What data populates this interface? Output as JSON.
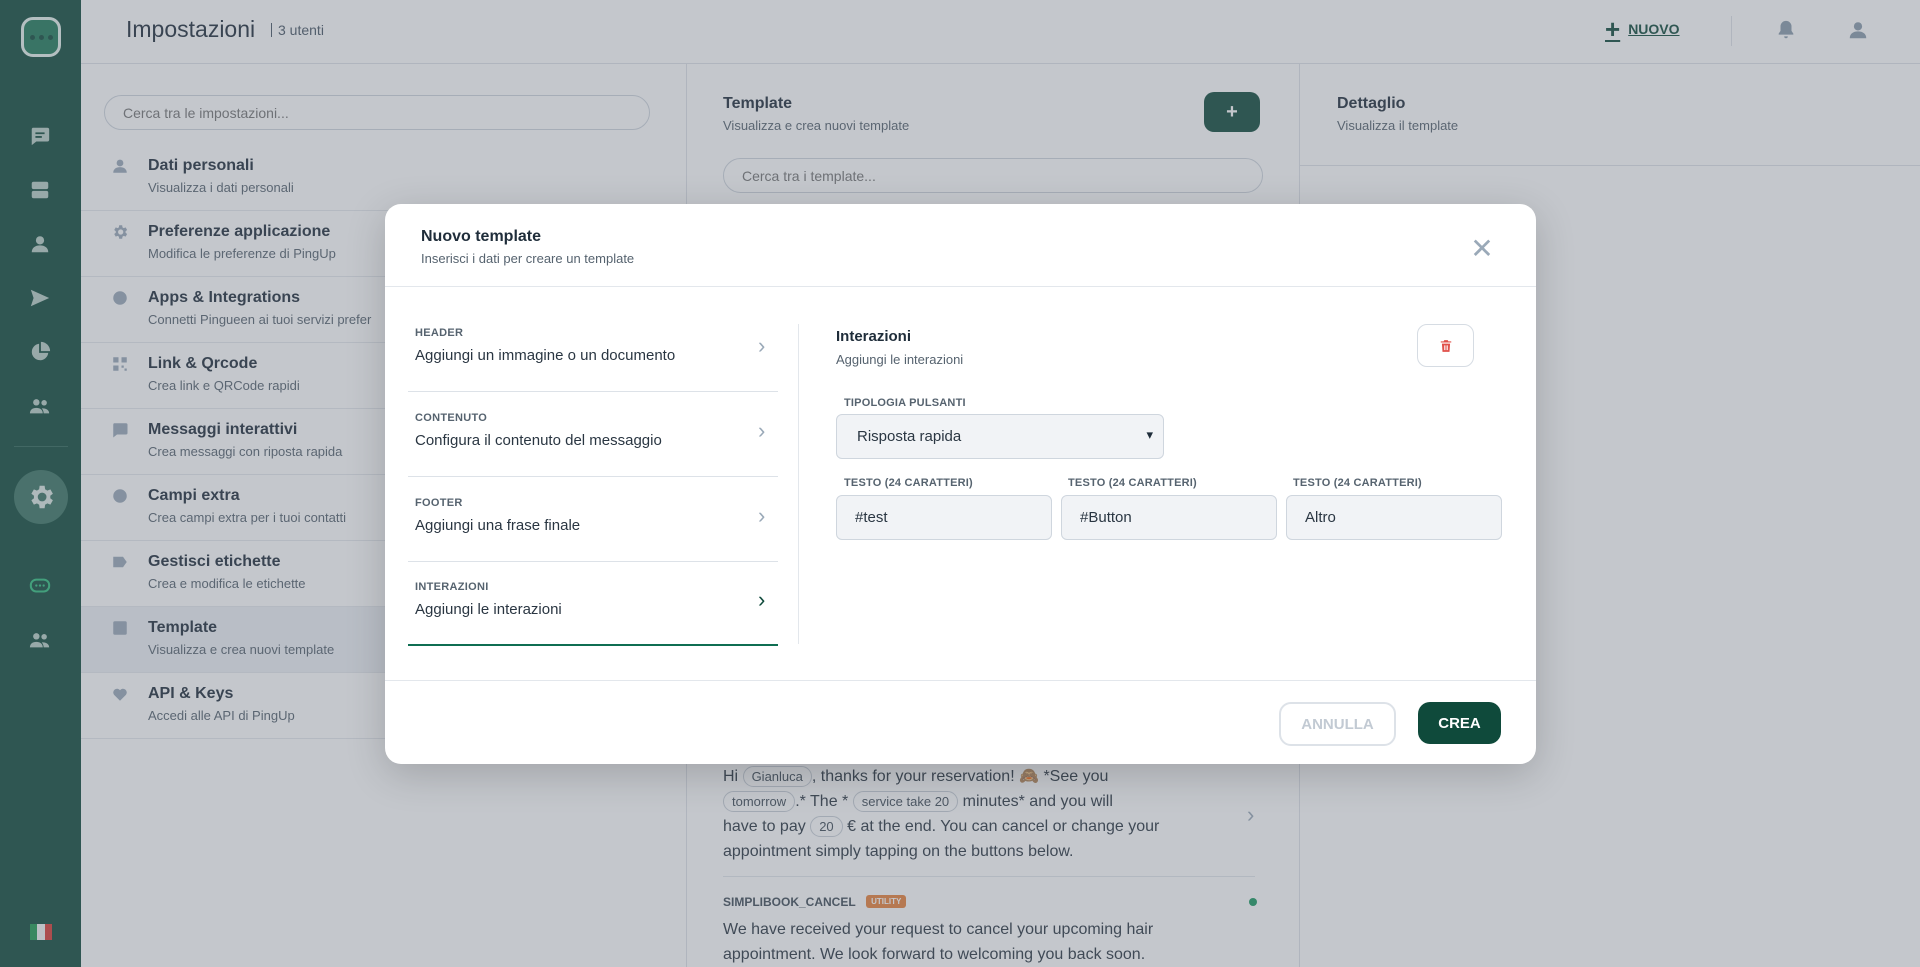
{
  "topbar": {
    "title": "Impostazioni",
    "subtitle": "3 utenti",
    "new_label": "NUOVO"
  },
  "settings": {
    "search_placeholder": "Cerca tra le impostazioni...",
    "items": [
      {
        "title": "Dati personali",
        "desc": "Visualizza i dati personali"
      },
      {
        "title": "Preferenze applicazione",
        "desc": "Modifica le preferenze di PingUp"
      },
      {
        "title": "Apps & Integrations",
        "desc": "Connetti Pingueen ai tuoi servizi prefer"
      },
      {
        "title": "Link & Qrcode",
        "desc": "Crea link e QRCode rapidi"
      },
      {
        "title": "Messaggi interattivi",
        "desc": "Crea messaggi con riposta rapida"
      },
      {
        "title": "Campi extra",
        "desc": "Crea campi extra per i tuoi contatti"
      },
      {
        "title": "Gestisci etichette",
        "desc": "Crea e modifica le etichette"
      },
      {
        "title": "Template",
        "desc": "Visualizza e crea nuovi template"
      },
      {
        "title": "API & Keys",
        "desc": "Accedi alle API di PingUp"
      }
    ]
  },
  "templates": {
    "title": "Template",
    "subtitle": "Visualizza e crea nuovi template",
    "add_label": "+",
    "search_placeholder": "Cerca tra i template...",
    "row1": {
      "t1": "Hi",
      "c1": "Gianluca",
      "t2": ", thanks for your reservation! 🙈 *See you",
      "c2": "tomorrow",
      "t3": ".* The *",
      "c3": "service take 20",
      "t4": "minutes* and you will",
      "t5": "have to pay",
      "c4": "20",
      "t6": "€ at the end. You can cancel or change your",
      "t7": "appointment simply tapping on the buttons below."
    },
    "row2": {
      "name": "SIMPLIBOOK_CANCEL",
      "badge": "UTILITY",
      "line1": "We have received your request to cancel your upcoming hair",
      "line2": "appointment. We look forward to welcoming you back soon."
    }
  },
  "detail": {
    "title": "Dettaglio",
    "subtitle": "Visualizza il template"
  },
  "modal": {
    "title": "Nuovo template",
    "subtitle": "Inserisci i dati per creare un template",
    "close": "✕",
    "steps": [
      {
        "label": "HEADER",
        "value": "Aggiungi un immagine o un documento"
      },
      {
        "label": "CONTENUTO",
        "value": "Configura il contenuto del messaggio"
      },
      {
        "label": "FOOTER",
        "value": "Aggiungi una frase finale"
      },
      {
        "label": "INTERAZIONI",
        "value": "Aggiungi le interazioni"
      }
    ],
    "panel_title": "Interazioni",
    "panel_subtitle": "Aggiungi le interazioni",
    "type_label": "TIPOLOGIA PULSANTI",
    "type_value": "Risposta rapida",
    "text_label": "TESTO (24 CARATTERI)",
    "texts": [
      "#test",
      "#Button",
      "Altro"
    ],
    "cancel_label": "ANNULLA",
    "create_label": "CREA"
  },
  "colors": {
    "brand": "#0f4a3b",
    "delete": "#e0504a",
    "status_ok": "#1a9a62",
    "badge": "#e8823a"
  }
}
